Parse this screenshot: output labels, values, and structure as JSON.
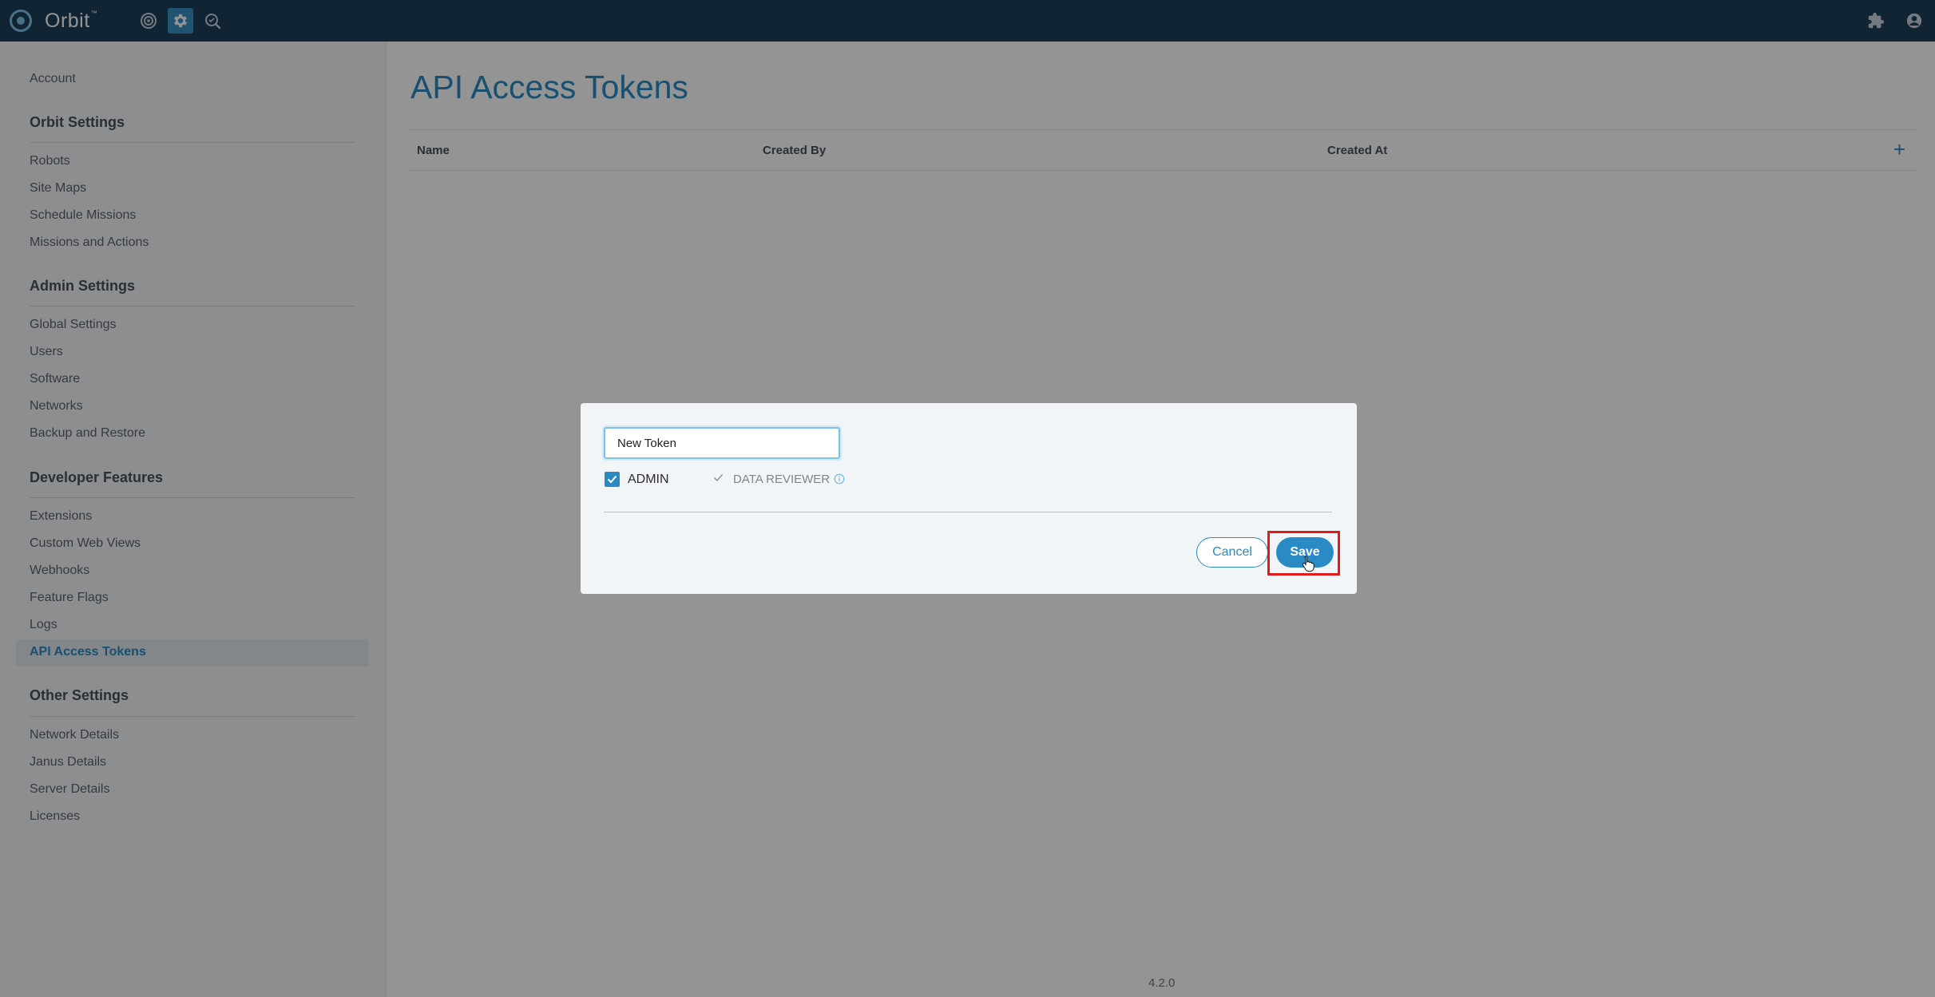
{
  "app": {
    "name": "Orbit",
    "trademark": "™",
    "version": "4.2.0"
  },
  "topbar": {
    "icons": [
      "target-icon",
      "gear-icon",
      "search-icon"
    ],
    "right_icons": [
      "puzzle-icon",
      "user-icon"
    ]
  },
  "sidebar": {
    "account": "Account",
    "sections": [
      {
        "title": "Orbit Settings",
        "items": [
          "Robots",
          "Site Maps",
          "Schedule Missions",
          "Missions and Actions"
        ]
      },
      {
        "title": "Admin Settings",
        "items": [
          "Global Settings",
          "Users",
          "Software",
          "Networks",
          "Backup and Restore"
        ]
      },
      {
        "title": "Developer Features",
        "items": [
          "Extensions",
          "Custom Web Views",
          "Webhooks",
          "Feature Flags",
          "Logs",
          "API Access Tokens"
        ]
      },
      {
        "title": "Other Settings",
        "items": [
          "Network Details",
          "Janus Details",
          "Server Details",
          "Licenses"
        ]
      }
    ],
    "active_item": "API Access Tokens"
  },
  "main": {
    "title": "API Access Tokens",
    "columns": [
      "Name",
      "Created By",
      "Created At"
    ],
    "add_icon": "+"
  },
  "modal": {
    "name_value": "New Token",
    "roles": [
      {
        "label": "ADMIN",
        "checked": true
      },
      {
        "label": "DATA REVIEWER",
        "checked": true,
        "disabled": true
      }
    ],
    "cancel_label": "Cancel",
    "save_label": "Save"
  },
  "colors": {
    "topbar": "#1e3f5a",
    "accent": "#2a8ac5",
    "highlight": "#e01b1b"
  }
}
